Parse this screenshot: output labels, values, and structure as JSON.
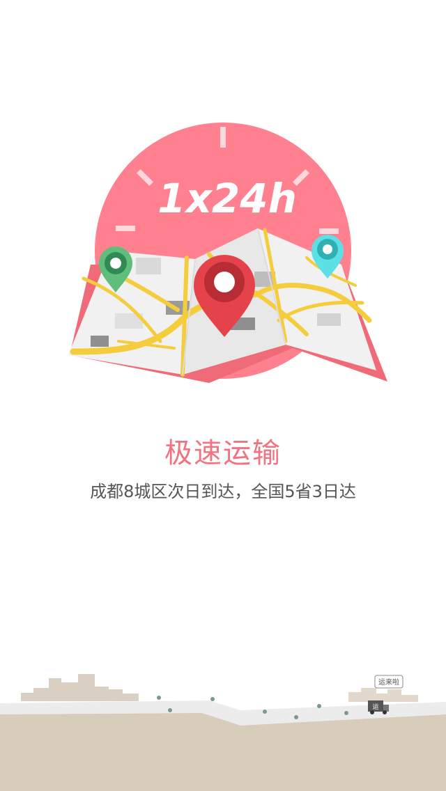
{
  "hero": {
    "clock_label": "1x24h",
    "pin_icons": [
      "map-pin-green-icon",
      "map-pin-red-icon",
      "map-pin-cyan-icon"
    ],
    "colors": {
      "clock": "#ff808f",
      "map_edge": "#ef6b78",
      "road": "#f4cc3c",
      "pin_red": "#e5434b",
      "pin_green": "#5fbe7b",
      "pin_cyan": "#5ce0e6"
    }
  },
  "content": {
    "title": "极速运输",
    "subtitle": "成都8城区次日到达，全国5省3日达"
  },
  "footer": {
    "truck_sign": "运",
    "speech": "运来啦"
  }
}
